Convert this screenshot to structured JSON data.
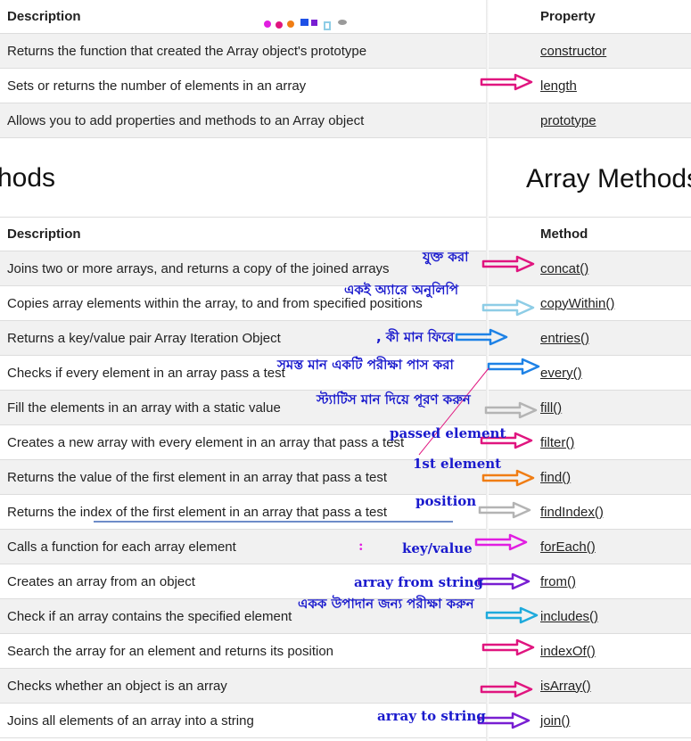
{
  "left_pane": {
    "property_table": {
      "header": "Description",
      "rows": [
        "Returns the function that created the Array object's prototype",
        "Sets or returns the number of elements in an array",
        "Allows you to add properties and methods to an Array object"
      ]
    },
    "section_title": "hods",
    "method_table": {
      "header": "Description",
      "rows": [
        "Joins two or more arrays, and returns a copy of the joined arrays",
        "Copies array elements within the array, to and from specified positions",
        "Returns a key/value pair Array Iteration Object",
        "Checks if every element in an array pass a test",
        "Fill the elements in an array with a static value",
        "Creates a new array with every element in an array that pass a test",
        "Returns the value of the first element in an array that pass a test",
        "Returns the index of the first element in an array that pass a test",
        "Calls a function for each array element",
        "Creates an array from an object",
        "Check if an array contains the specified element",
        "Search the array for an element and returns its position",
        "Checks whether an object is an array",
        "Joins all elements of an array into a string"
      ]
    }
  },
  "right_pane": {
    "property_table": {
      "header": "Property",
      "rows": [
        "constructor",
        "length",
        "prototype"
      ]
    },
    "section_title": "Array Methods",
    "method_table": {
      "header": "Method",
      "rows": [
        "concat()",
        "copyWithin()",
        "entries()",
        "every()",
        "fill()",
        "filter()",
        "find()",
        "findIndex()",
        "forEach()",
        "from()",
        "includes()",
        "indexOf()",
        "isArray()",
        "join()"
      ]
    }
  },
  "annotations": {
    "concat": "যুক্ত করা",
    "copyWithin": "একই অ্যারে অনুলিপি",
    "entries": ", কী মান ফিরে",
    "every": "সমস্ত মান একটি পরীক্ষা পাস করা",
    "fill": "স্ট্যাটিস মান দিয়ে পূরণ করুন",
    "filter": "passed element",
    "find": "1st element",
    "findIndex": "position",
    "forEach_colon": ":",
    "forEach": "key/value",
    "from": "array from string",
    "includes": "একক উপাদান জন্য পরীক্ষা করুন",
    "join": "array to string"
  },
  "colors": {
    "annotation_blue": "#1a1acd",
    "pink": "#e0157f",
    "light_blue": "#8ecde6",
    "blue": "#1e82e6",
    "gray_arrow": "#b4b4b4",
    "orange": "#f07d14",
    "magenta": "#e11ee1",
    "purple": "#781ed2",
    "teal": "#1eaadc",
    "underline_blue": "#6e8cc8"
  }
}
